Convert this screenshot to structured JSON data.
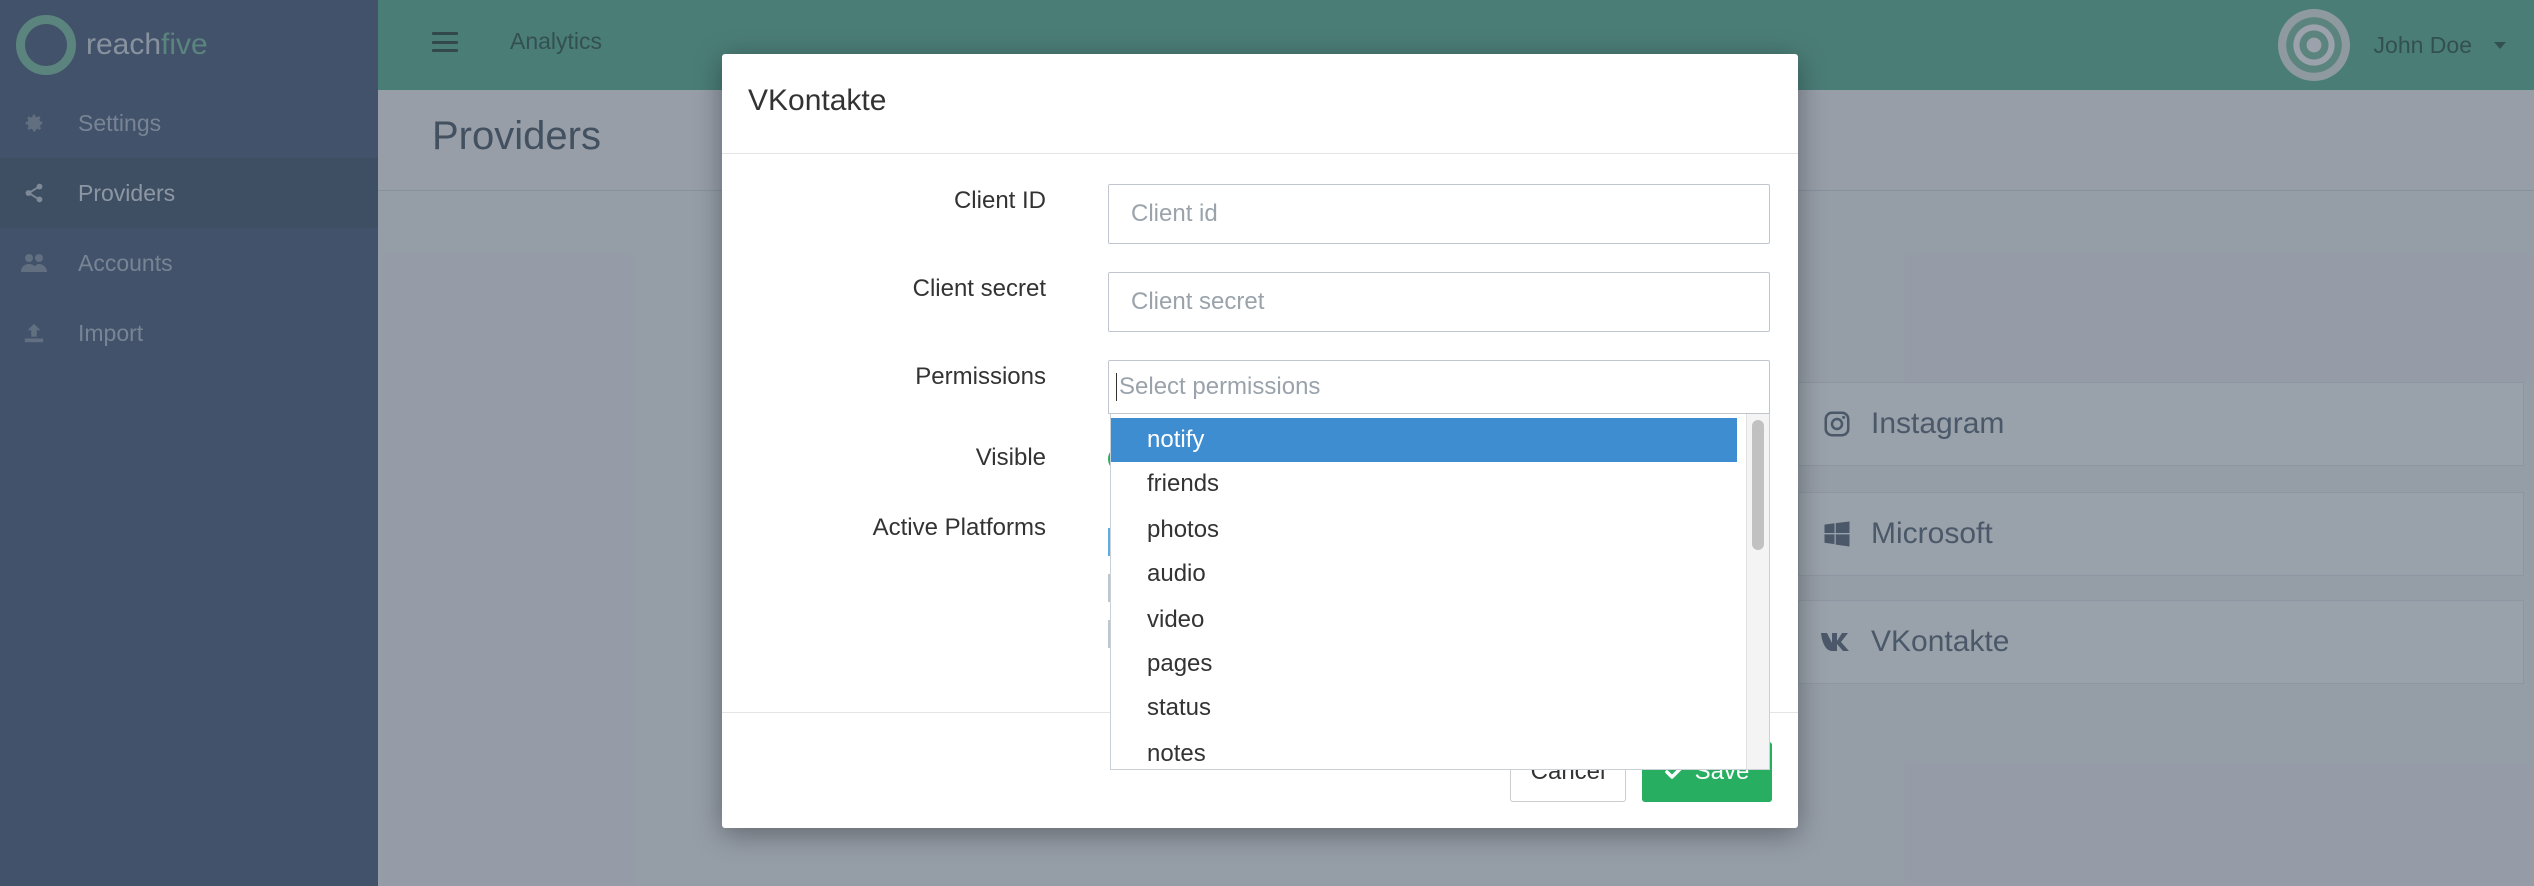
{
  "brand": {
    "part1": "reach",
    "part2": "five",
    "ring_color": "#7fc3a4"
  },
  "sidebar": {
    "items": [
      {
        "label": "Settings",
        "icon": "gear-icon"
      },
      {
        "label": "Providers",
        "icon": "share-icon",
        "active": true
      },
      {
        "label": "Accounts",
        "icon": "users-icon"
      },
      {
        "label": "Import",
        "icon": "upload-icon"
      }
    ]
  },
  "topbar": {
    "menu_icon": "list-icon",
    "link": "Analytics",
    "user_name": "John Doe",
    "color": "#5fb596"
  },
  "page": {
    "title": "Providers",
    "providers": [
      {
        "name": "Instagram",
        "icon": "instagram-icon"
      },
      {
        "name": "Microsoft",
        "icon": "windows-icon"
      },
      {
        "name": "VKontakte",
        "icon": "vk-icon"
      }
    ]
  },
  "modal": {
    "title": "VKontakte",
    "labels": {
      "client_id": "Client ID",
      "client_secret": "Client secret",
      "permissions": "Permissions",
      "visible": "Visible",
      "active_platforms": "Active Platforms"
    },
    "placeholders": {
      "client_id": "Client id",
      "client_secret": "Client secret",
      "permissions": "Select permissions"
    },
    "permissions_options": [
      "notify",
      "friends",
      "photos",
      "audio",
      "video",
      "pages",
      "status",
      "notes"
    ],
    "highlighted_option": "notify",
    "buttons": {
      "cancel": "Cancel",
      "save": "Save"
    },
    "accent_color": "#27ae60",
    "highlight_color": "#3f8dd1"
  }
}
